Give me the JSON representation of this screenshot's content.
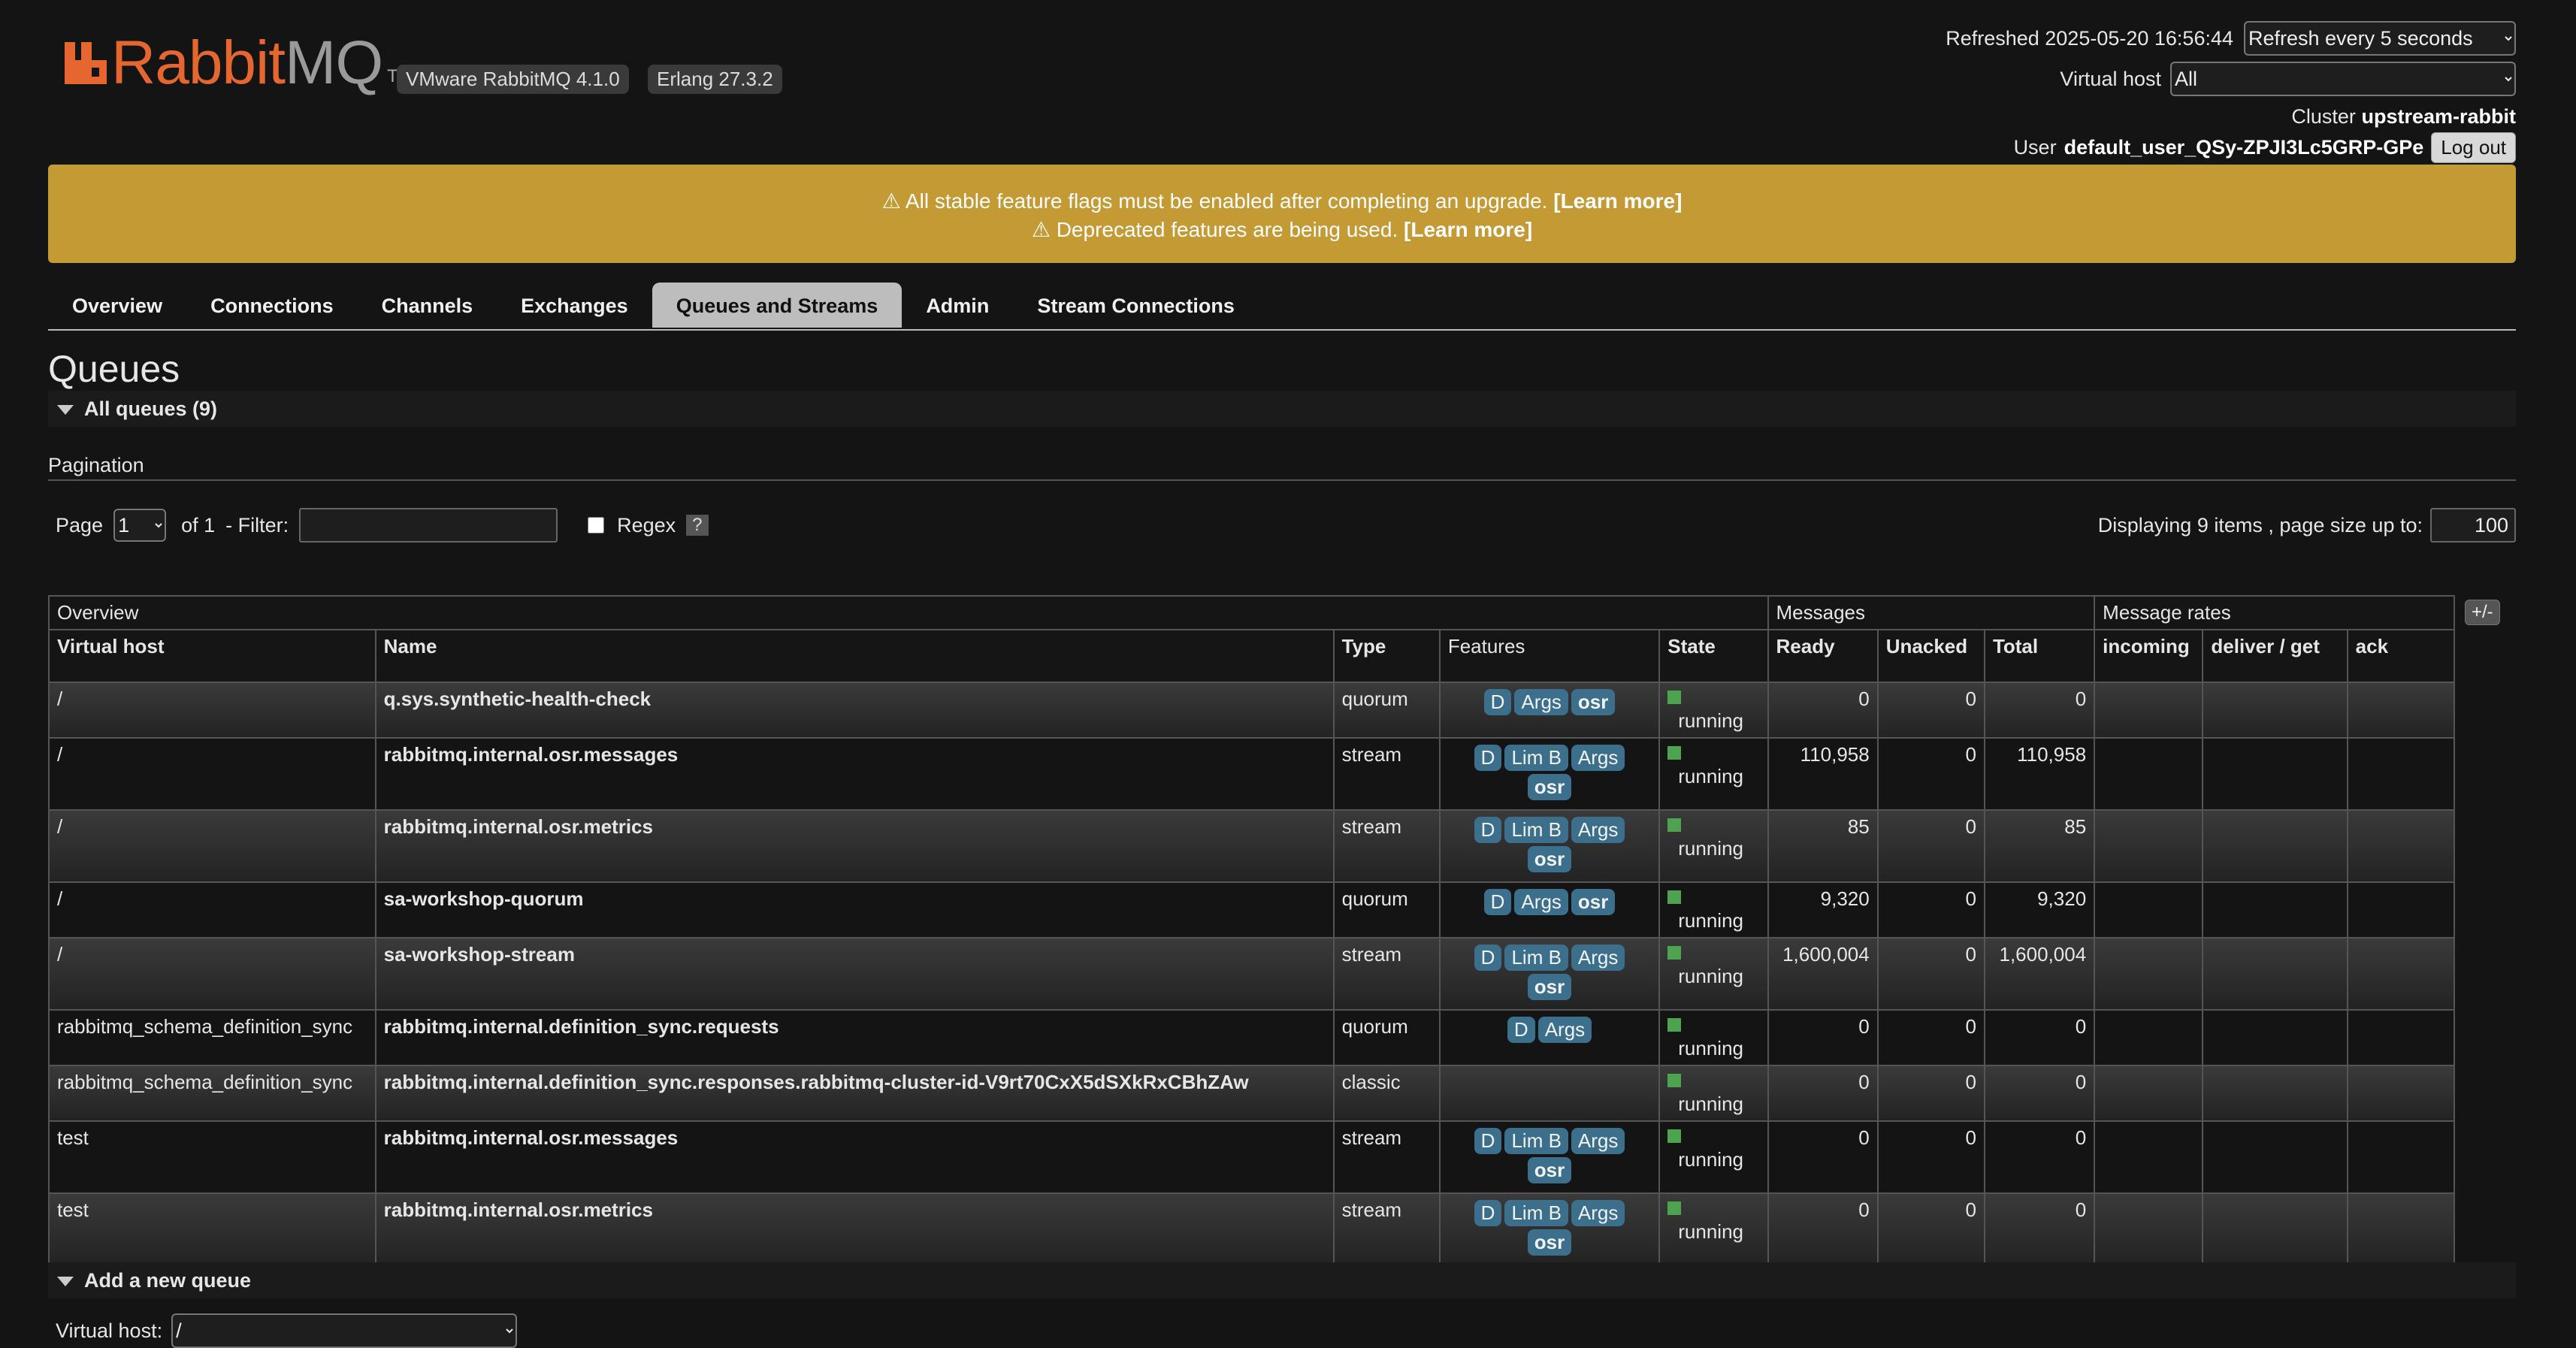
{
  "header": {
    "logo_rabbit": "Rabbit",
    "logo_mq": "MQ",
    "logo_tm": "TM",
    "version_badge": "VMware RabbitMQ 4.1.0",
    "erlang_badge": "Erlang 27.3.2",
    "refreshed_label": "Refreshed 2025-05-20 16:56:44",
    "refresh_option": "Refresh every 5 seconds",
    "vhost_label": "Virtual host",
    "vhost_value": "All",
    "cluster_label": "Cluster",
    "cluster_name": "upstream-rabbit",
    "user_label": "User",
    "user_name": "default_user_QSy-ZPJI3Lc5GRP-GPe",
    "logout_label": "Log out"
  },
  "warnings": [
    {
      "text": "⚠ All stable feature flags must be enabled after completing an upgrade.",
      "link": "[Learn more]"
    },
    {
      "text": "⚠ Deprecated features are being used.",
      "link": "[Learn more]"
    }
  ],
  "tabs": [
    "Overview",
    "Connections",
    "Channels",
    "Exchanges",
    "Queues and Streams",
    "Admin",
    "Stream Connections"
  ],
  "active_tab": "Queues and Streams",
  "page_title": "Queues",
  "all_queues_label": "All queues (9)",
  "pagination": {
    "heading": "Pagination",
    "page_label": "Page",
    "page_value": "1",
    "of_label": "of 1",
    "filter_label": "- Filter:",
    "filter_value": "",
    "regex_label": "Regex",
    "help_label": "?",
    "displaying_label": "Displaying 9 items , page size up to:",
    "page_size": "100"
  },
  "table": {
    "group_overview": "Overview",
    "group_messages": "Messages",
    "group_rates": "Message rates",
    "toggle_label": "+/-",
    "columns": [
      "Virtual host",
      "Name",
      "Type",
      "Features",
      "State",
      "Ready",
      "Unacked",
      "Total",
      "incoming",
      "deliver / get",
      "ack"
    ],
    "rows": [
      {
        "vhost": "/",
        "name": "q.sys.synthetic-health-check",
        "type": "quorum",
        "features": [
          "D",
          "Args",
          "osr"
        ],
        "state": "running",
        "ready": "0",
        "unacked": "0",
        "total": "0"
      },
      {
        "vhost": "/",
        "name": "rabbitmq.internal.osr.messages",
        "type": "stream",
        "features": [
          "D",
          "Lim B",
          "Args",
          "osr"
        ],
        "state": "running",
        "ready": "110,958",
        "unacked": "0",
        "total": "110,958"
      },
      {
        "vhost": "/",
        "name": "rabbitmq.internal.osr.metrics",
        "type": "stream",
        "features": [
          "D",
          "Lim B",
          "Args",
          "osr"
        ],
        "state": "running",
        "ready": "85",
        "unacked": "0",
        "total": "85"
      },
      {
        "vhost": "/",
        "name": "sa-workshop-quorum",
        "type": "quorum",
        "features": [
          "D",
          "Args",
          "osr"
        ],
        "state": "running",
        "ready": "9,320",
        "unacked": "0",
        "total": "9,320"
      },
      {
        "vhost": "/",
        "name": "sa-workshop-stream",
        "type": "stream",
        "features": [
          "D",
          "Lim B",
          "Args",
          "osr"
        ],
        "state": "running",
        "ready": "1,600,004",
        "unacked": "0",
        "total": "1,600,004"
      },
      {
        "vhost": "rabbitmq_schema_definition_sync",
        "name": "rabbitmq.internal.definition_sync.requests",
        "type": "quorum",
        "features": [
          "D",
          "Args"
        ],
        "state": "running",
        "ready": "0",
        "unacked": "0",
        "total": "0"
      },
      {
        "vhost": "rabbitmq_schema_definition_sync",
        "name": "rabbitmq.internal.definition_sync.responses.rabbitmq-cluster-id-V9rt70CxX5dSXkRxCBhZAw",
        "type": "classic",
        "features": [],
        "state": "running",
        "ready": "0",
        "unacked": "0",
        "total": "0"
      },
      {
        "vhost": "test",
        "name": "rabbitmq.internal.osr.messages",
        "type": "stream",
        "features": [
          "D",
          "Lim B",
          "Args",
          "osr"
        ],
        "state": "running",
        "ready": "0",
        "unacked": "0",
        "total": "0"
      },
      {
        "vhost": "test",
        "name": "rabbitmq.internal.osr.metrics",
        "type": "stream",
        "features": [
          "D",
          "Lim B",
          "Args",
          "osr"
        ],
        "state": "running",
        "ready": "0",
        "unacked": "0",
        "total": "0"
      }
    ]
  },
  "add_queue_label": "Add a new queue",
  "add_queue_vhost_label": "Virtual host:",
  "add_queue_vhost_value": "/",
  "colors": {
    "accent": "#e5672f",
    "warning": "#c49a35",
    "tag": "#3b6f8c",
    "running": "#4ea34e",
    "active_tab": "#bdbdbd"
  }
}
